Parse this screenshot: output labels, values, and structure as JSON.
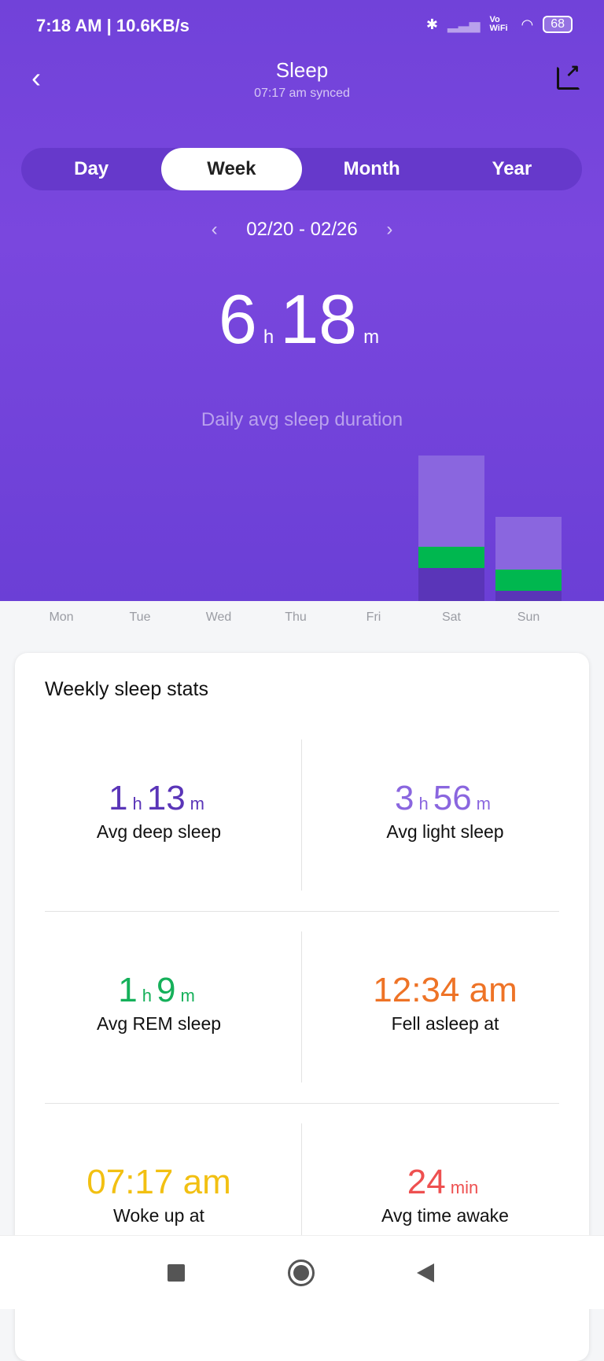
{
  "status_bar": {
    "time": "7:18 AM | 10.6KB/s",
    "vowifi": "Vo WiFi",
    "battery": "68"
  },
  "header": {
    "title": "Sleep",
    "subtitle": "07:17 am synced"
  },
  "tabs": [
    {
      "label": "Day"
    },
    {
      "label": "Week",
      "active": true
    },
    {
      "label": "Month"
    },
    {
      "label": "Year"
    }
  ],
  "date_range": "02/20 - 02/26",
  "summary": {
    "hours": "6",
    "hours_unit": "h",
    "minutes": "18",
    "minutes_unit": "m",
    "label": "Daily avg sleep duration"
  },
  "chart_data": {
    "type": "bar",
    "stacked": true,
    "categories": [
      "Mon",
      "Tue",
      "Wed",
      "Thu",
      "Fri",
      "Sat",
      "Sun"
    ],
    "series": [
      {
        "key": "deep",
        "color": "#5a35b8",
        "values": [
          0,
          0,
          0,
          0,
          0,
          109,
          35
        ]
      },
      {
        "key": "rem",
        "color": "#00b74f",
        "values": [
          0,
          0,
          0,
          0,
          0,
          70,
          70
        ]
      },
      {
        "key": "light",
        "color": "#8a66df",
        "values": [
          0,
          0,
          0,
          0,
          0,
          301,
          174
        ]
      }
    ]
  },
  "stats": {
    "title": "Weekly sleep stats",
    "items": [
      {
        "parts": [
          [
            "1",
            "h"
          ],
          [
            "13",
            "m"
          ]
        ],
        "label": "Avg deep sleep",
        "color": "#5a35b8"
      },
      {
        "parts": [
          [
            "3",
            "h"
          ],
          [
            "56",
            "m"
          ]
        ],
        "label": "Avg light sleep",
        "color": "#8a66df"
      },
      {
        "parts": [
          [
            "1",
            "h"
          ],
          [
            "9",
            "m"
          ]
        ],
        "label": "Avg REM sleep",
        "color": "#15b05a"
      },
      {
        "parts": [
          [
            "12:34 am",
            ""
          ]
        ],
        "label": "Fell asleep at",
        "color": "#ee7326"
      },
      {
        "parts": [
          [
            "07:17 am",
            ""
          ]
        ],
        "label": "Woke up at",
        "color": "#f2c012"
      },
      {
        "parts": [
          [
            "24",
            "min"
          ]
        ],
        "label": "Avg time awake",
        "color": "#ee5050"
      }
    ]
  }
}
